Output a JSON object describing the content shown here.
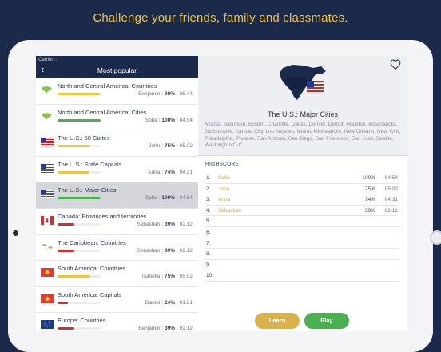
{
  "headline": "Challenge your friends, family and classmates.",
  "status_bar": {
    "carrier": "Carrier"
  },
  "sidebar": {
    "title": "Most popular",
    "items": [
      {
        "name": "North and Central America: Countries",
        "player": "Benjamin",
        "percent": "98%",
        "time": "05.44",
        "progress": 0.98,
        "bar_color": "#f0c33c",
        "flag": "north-america-map"
      },
      {
        "name": "North and Central America: Cities",
        "player": "Sofia",
        "percent": "100%",
        "time": "04.54",
        "progress": 1.0,
        "bar_color": "#4caf50",
        "flag": "north-america-map"
      },
      {
        "name": "The U.S.: 50 States",
        "player": "John",
        "percent": "75%",
        "time": "05.02",
        "progress": 0.75,
        "bar_color": "#f0c33c",
        "flag": "us-flag"
      },
      {
        "name": "The U.S.: State Capitals",
        "player": "Anna",
        "percent": "74%",
        "time": "04.31",
        "progress": 0.74,
        "bar_color": "#f0c33c",
        "flag": "us-flag"
      },
      {
        "name": "The U.S.: Major Cities",
        "player": "Sofia",
        "percent": "100%",
        "time": "04.54",
        "progress": 1.0,
        "bar_color": "#4caf50",
        "flag": "us-flag",
        "selected": true
      },
      {
        "name": "Canada: Provinces and territories",
        "player": "Sebastian",
        "percent": "39%",
        "time": "02.12",
        "progress": 0.39,
        "bar_color": "#d32f2f",
        "flag": "canada-flag"
      },
      {
        "name": "The Caribbean: Countries",
        "player": "Sebastian",
        "percent": "39%",
        "time": "02.12",
        "progress": 0.39,
        "bar_color": "#d32f2f",
        "flag": "caribbean-map"
      },
      {
        "name": "South America: Countries",
        "player": "Isabella",
        "percent": "75%",
        "time": "05.02",
        "progress": 0.75,
        "bar_color": "#f0c33c",
        "flag": "south-america-flag"
      },
      {
        "name": "South America: Capitals",
        "player": "Daniel",
        "percent": "24%",
        "time": "01.31",
        "progress": 0.24,
        "bar_color": "#d32f2f",
        "flag": "south-america-flag"
      },
      {
        "name": "Europe: Countries",
        "player": "Benjamin",
        "percent": "39%",
        "time": "02.12",
        "progress": 0.39,
        "bar_color": "#d32f2f",
        "flag": "eu-flag"
      }
    ]
  },
  "detail": {
    "title": "The U.S.: Major Cities",
    "description": "Atlanta, Baltimore, Boston, Charlotte, Dallas, Denver, Detroit, Houston, Indianapolis, Jacksonville, Kansas City, Los Angeles, Miami, Minneapolis, New Orleans, New York, Philadelphia, Phoenix, San Antonio, San Diego, San Francisco, San José, Seattle, Washington D.C.",
    "highscore_label": "HIGHSCORE",
    "highscores": [
      {
        "rank": "1.",
        "name": "Sofia",
        "percent": "100%",
        "time": "04.54"
      },
      {
        "rank": "2.",
        "name": "John",
        "percent": "75%",
        "time": "05.02"
      },
      {
        "rank": "3.",
        "name": "Anna",
        "percent": "74%",
        "time": "04.31"
      },
      {
        "rank": "4.",
        "name": "Sebastian",
        "percent": "39%",
        "time": "02.12"
      },
      {
        "rank": "5.",
        "name": "",
        "percent": "",
        "time": ""
      },
      {
        "rank": "6.",
        "name": "",
        "percent": "",
        "time": ""
      },
      {
        "rank": "7.",
        "name": "",
        "percent": "",
        "time": ""
      },
      {
        "rank": "8.",
        "name": "",
        "percent": "",
        "time": ""
      },
      {
        "rank": "9.",
        "name": "",
        "percent": "",
        "time": ""
      },
      {
        "rank": "10.",
        "name": "",
        "percent": "",
        "time": ""
      }
    ],
    "learn_label": "Learn",
    "play_label": "Play"
  },
  "colors": {
    "navy": "#1b2a4a",
    "gold": "#f0c33c",
    "green": "#4caf50",
    "red": "#d32f2f"
  }
}
